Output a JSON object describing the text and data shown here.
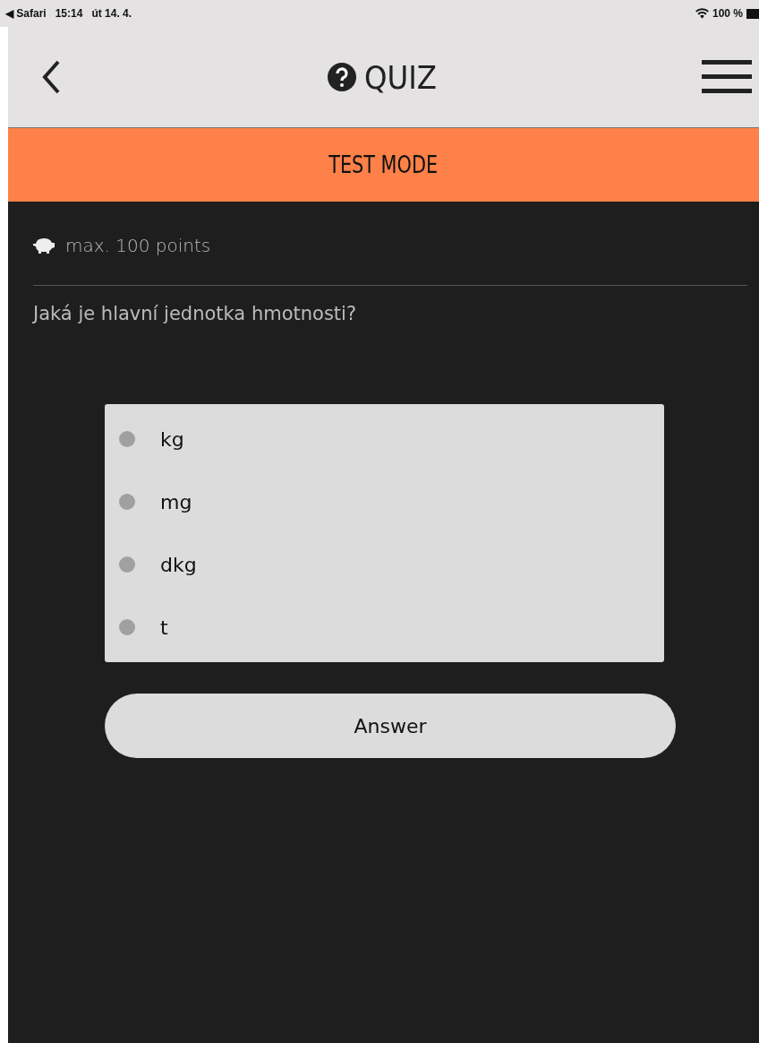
{
  "status_bar": {
    "back_app": "◀ Safari",
    "time": "15:14",
    "date": "út 14. 4.",
    "battery": "100 %"
  },
  "header": {
    "title": "QUIZ"
  },
  "mode_banner": {
    "label": "TEST MODE"
  },
  "points": {
    "label": "max. 100 points"
  },
  "question": {
    "text": "Jaká je hlavní jednotka hmotnosti?"
  },
  "options": [
    {
      "label": "kg",
      "selected": false
    },
    {
      "label": "mg",
      "selected": false
    },
    {
      "label": "dkg",
      "selected": false
    },
    {
      "label": "t",
      "selected": false
    }
  ],
  "answer_button": {
    "label": "Answer"
  }
}
